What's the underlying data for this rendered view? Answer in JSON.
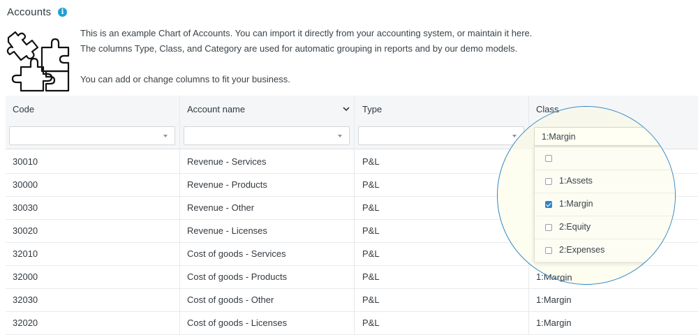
{
  "page": {
    "title": "Accounts",
    "info_icon": "info-icon",
    "illustration_icon": "puzzle-pieces-icon",
    "description": [
      "This is an example Chart of Accounts. You can import it directly from your accounting system, or maintain it here.",
      "The columns Type, Class, and Category are used for automatic grouping in reports and by our demo models.",
      "You can add or change columns to fit your business."
    ]
  },
  "table": {
    "columns": [
      "Code",
      "Account name",
      "Type",
      "Class"
    ],
    "filters": [
      "",
      "",
      "",
      "1:Margin"
    ],
    "rows": [
      [
        "30010",
        "Revenue - Services",
        "P&L",
        ""
      ],
      [
        "30000",
        "Revenue - Products",
        "P&L",
        ""
      ],
      [
        "30030",
        "Revenue - Other",
        "P&L",
        ""
      ],
      [
        "30020",
        "Revenue - Licenses",
        "P&L",
        ""
      ],
      [
        "32010",
        "Cost of goods - Services",
        "P&L",
        ""
      ],
      [
        "32000",
        "Cost of goods - Products",
        "P&L",
        "1:Margin"
      ],
      [
        "32030",
        "Cost of goods - Other",
        "P&L",
        "1:Margin"
      ],
      [
        "32020",
        "Cost of goods - Licenses",
        "P&L",
        "1:Margin"
      ]
    ]
  },
  "class_filter_dropdown": {
    "options": [
      {
        "label": "",
        "checked": false
      },
      {
        "label": "1:Assets",
        "checked": false
      },
      {
        "label": "1:Margin",
        "checked": true
      },
      {
        "label": "2:Equity",
        "checked": false
      },
      {
        "label": "2:Expenses",
        "checked": false
      }
    ]
  },
  "colors": {
    "accent": "#2f86c6",
    "info": "#1e9fd6",
    "header_bg": "#f5f6f7",
    "lens_bg": "#fefef0"
  }
}
